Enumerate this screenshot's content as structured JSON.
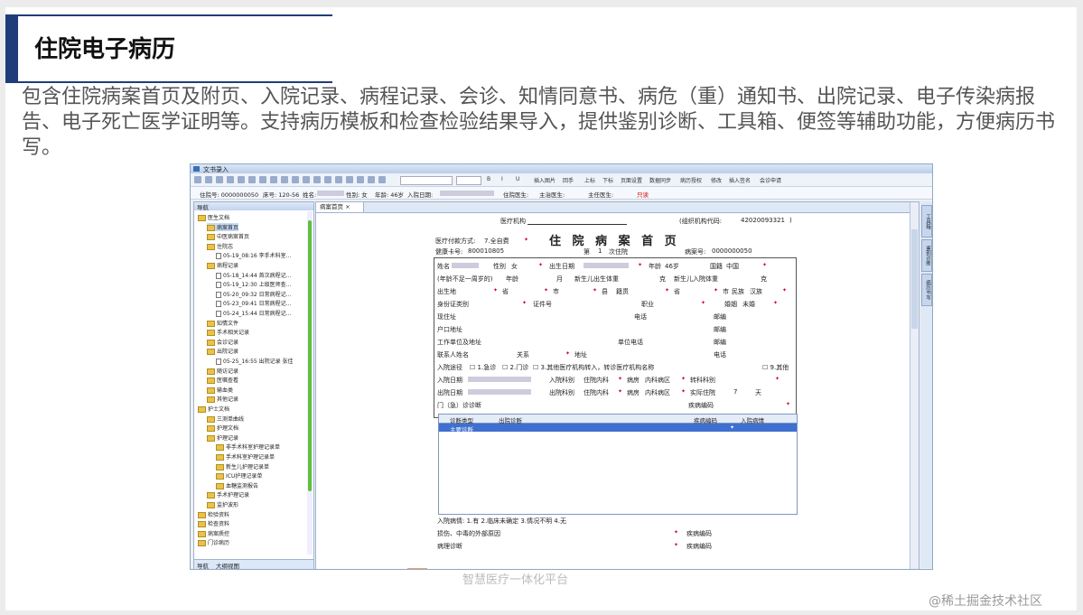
{
  "slide": {
    "title": "住院电子病历",
    "description": "包含住院病案首页及附页、入院记录、病程记录、会诊、知情同意书、病危（重）通知书、出院记录、电子传染病报告、电子死亡医学证明等。支持病历模板和检查检验结果导入，提供鉴别诊断、工具箱、便签等辅助功能，方便病历书写。",
    "footer": "智慧医疗一体化平台",
    "watermark": "@稀土掘金技术社区"
  },
  "window": {
    "title": "文书录入",
    "toolbar_labels": [
      "插入图片",
      "回手",
      "上标",
      "下标",
      "页面设置",
      "数据同步",
      "病历授权",
      "修改",
      "插入签名",
      "会诊申请"
    ],
    "info": {
      "bed_label": "住院号: 0000000050",
      "bed_no": "床号: 120-56",
      "name_label": "姓名:",
      "gender": "性别: 女",
      "age": "年龄: 46岁",
      "admit_label": "入院日期:",
      "doctor_label": "住院医生:",
      "main_doctor": "主治医生:",
      "chief_doctor": "主任医生:",
      "readonly": "只读"
    }
  },
  "nav": {
    "header": "导航",
    "tabs": [
      "导航",
      "大纲视图"
    ],
    "tree": [
      {
        "label": "医生文档",
        "level": 0,
        "type": "folder"
      },
      {
        "label": "病案首页",
        "level": 1,
        "type": "folder",
        "selected": true
      },
      {
        "label": "中医病案首页",
        "level": 1,
        "type": "folder"
      },
      {
        "label": "住院志",
        "level": 1,
        "type": "folder"
      },
      {
        "label": "05-19_08:16 李手术科室...",
        "level": 2,
        "type": "doc"
      },
      {
        "label": "病程记录",
        "level": 1,
        "type": "folder"
      },
      {
        "label": "05-18_14:44 首次病程记...",
        "level": 2,
        "type": "doc"
      },
      {
        "label": "05-19_12:30 上级医师查...",
        "level": 2,
        "type": "doc"
      },
      {
        "label": "05-20_09:32 日常病程记...",
        "level": 2,
        "type": "doc"
      },
      {
        "label": "05-23_09:41 日常病程记...",
        "level": 2,
        "type": "doc"
      },
      {
        "label": "05-24_15:44 日常病程记...",
        "level": 2,
        "type": "doc"
      },
      {
        "label": "知情文件",
        "level": 1,
        "type": "folder"
      },
      {
        "label": "手术相关记录",
        "level": 1,
        "type": "folder"
      },
      {
        "label": "会诊记录",
        "level": 1,
        "type": "folder"
      },
      {
        "label": "出院记录",
        "level": 1,
        "type": "folder"
      },
      {
        "label": "05-25_16:55 出院记录 张佳",
        "level": 2,
        "type": "doc"
      },
      {
        "label": "随访记录",
        "level": 1,
        "type": "folder"
      },
      {
        "label": "医嘱查看",
        "level": 1,
        "type": "folder"
      },
      {
        "label": "输血类",
        "level": 1,
        "type": "folder"
      },
      {
        "label": "其他记录",
        "level": 1,
        "type": "folder"
      },
      {
        "label": "护士文档",
        "level": 0,
        "type": "folder"
      },
      {
        "label": "三测单曲线",
        "level": 1,
        "type": "folder"
      },
      {
        "label": "护理文档",
        "level": 1,
        "type": "folder"
      },
      {
        "label": "护理记录",
        "level": 1,
        "type": "folder"
      },
      {
        "label": "非手术科室护理记录单",
        "level": 2,
        "type": "folder"
      },
      {
        "label": "手术科室护理记录单",
        "level": 2,
        "type": "folder"
      },
      {
        "label": "新生儿护理记录单",
        "level": 2,
        "type": "folder"
      },
      {
        "label": "ICU护理记录单",
        "level": 2,
        "type": "folder"
      },
      {
        "label": "血糖监测报告",
        "level": 2,
        "type": "folder"
      },
      {
        "label": "手术护理记录",
        "level": 1,
        "type": "folder"
      },
      {
        "label": "监护波形",
        "level": 1,
        "type": "folder"
      },
      {
        "label": "检验资料",
        "level": 0,
        "type": "folder"
      },
      {
        "label": "检查资料",
        "level": 0,
        "type": "folder"
      },
      {
        "label": "病案质控",
        "level": 0,
        "type": "folder"
      },
      {
        "label": "门诊病历",
        "level": 0,
        "type": "folder"
      }
    ]
  },
  "doc": {
    "tab": "病案首页",
    "form_title": "住 院 病 案 首 页",
    "org_label": "医疗机构",
    "org_code_label": "(组织机构代码:",
    "org_code": "42020093321",
    "pay_label": "医疗付款方式:",
    "pay_value": "7.全自费",
    "health_card_label": "健康卡号:",
    "health_card": "800010805",
    "times_label": "第",
    "times_value": "1",
    "times_suffix": "次住院",
    "case_no_label": "病案号:",
    "case_no": "0000000050",
    "name_label": "姓名",
    "gender_label": "性别",
    "gender": "女",
    "birth_label": "出生日期",
    "age_label": "年龄",
    "age": "46岁",
    "nation_label": "国籍",
    "nation": "中国",
    "infant_age_label": "(年龄不足一周岁的)",
    "infant_age": "年龄",
    "month": "月",
    "newborn_weight": "新生儿出生体重",
    "gram": "克",
    "newborn_admit_weight": "新生儿入院体重",
    "gram2": "克",
    "birthplace_label": "出生地",
    "province": "省",
    "city": "市",
    "county": "县",
    "native_label": "籍贯",
    "province2": "省",
    "city2": "市",
    "ethnic_label": "民族",
    "ethnic": "汉族",
    "id_type_label": "身份证类别",
    "id_no_label": "证件号",
    "job_label": "职业",
    "marriage_label": "婚姻",
    "marriage": "未婚",
    "address_label": "现住址",
    "phone_label": "电话",
    "zip_label": "邮编",
    "hukou_label": "户口地址",
    "zip2_label": "邮编",
    "work_label": "工作单位及地址",
    "work_phone_label": "单位电话",
    "zip3_label": "邮编",
    "contact_label": "联系人姓名",
    "relation_label": "关系",
    "contact_addr_label": "地址",
    "contact_phone_label": "电话",
    "admit_route_label": "入院途径",
    "route1": "1.急诊",
    "route2": "2.门诊",
    "route3": "3.其他医疗机构转入，转诊医疗机构名称",
    "route9": "9.其他",
    "admit_date_label": "入院日期",
    "admit_dept_label": "入院科别",
    "admit_dept": "住院内科",
    "ward_label": "病房",
    "ward": "内科病区",
    "transfer_label": "转科科别",
    "discharge_date_label": "出院日期",
    "discharge_dept_label": "出院科别",
    "discharge_dept": "住院内科",
    "ward2_label": "病房",
    "ward2": "内科病区",
    "actual_days_label": "实际住院",
    "actual_days": "7",
    "day": "天",
    "outpatient_diag_label": "门（急）诊诊断",
    "disease_code_label": "疾病编码",
    "grid_headers": [
      "诊断类型",
      "出院诊断",
      "疾病编码",
      "入院病情"
    ],
    "grid_row": [
      "主要诊断",
      "",
      "",
      ""
    ],
    "admit_cond_note": "入院病情: 1.有 2.临床未确定 3.情况不明 4.无",
    "injury_label": "损伤、中毒的外部原因",
    "injury_code_label": "疾病编码",
    "path_label": "病理诊断",
    "path_code_label": "疾病编码"
  },
  "right_tabs": [
    "工具箱",
    "鉴别诊断",
    "病历书写"
  ]
}
